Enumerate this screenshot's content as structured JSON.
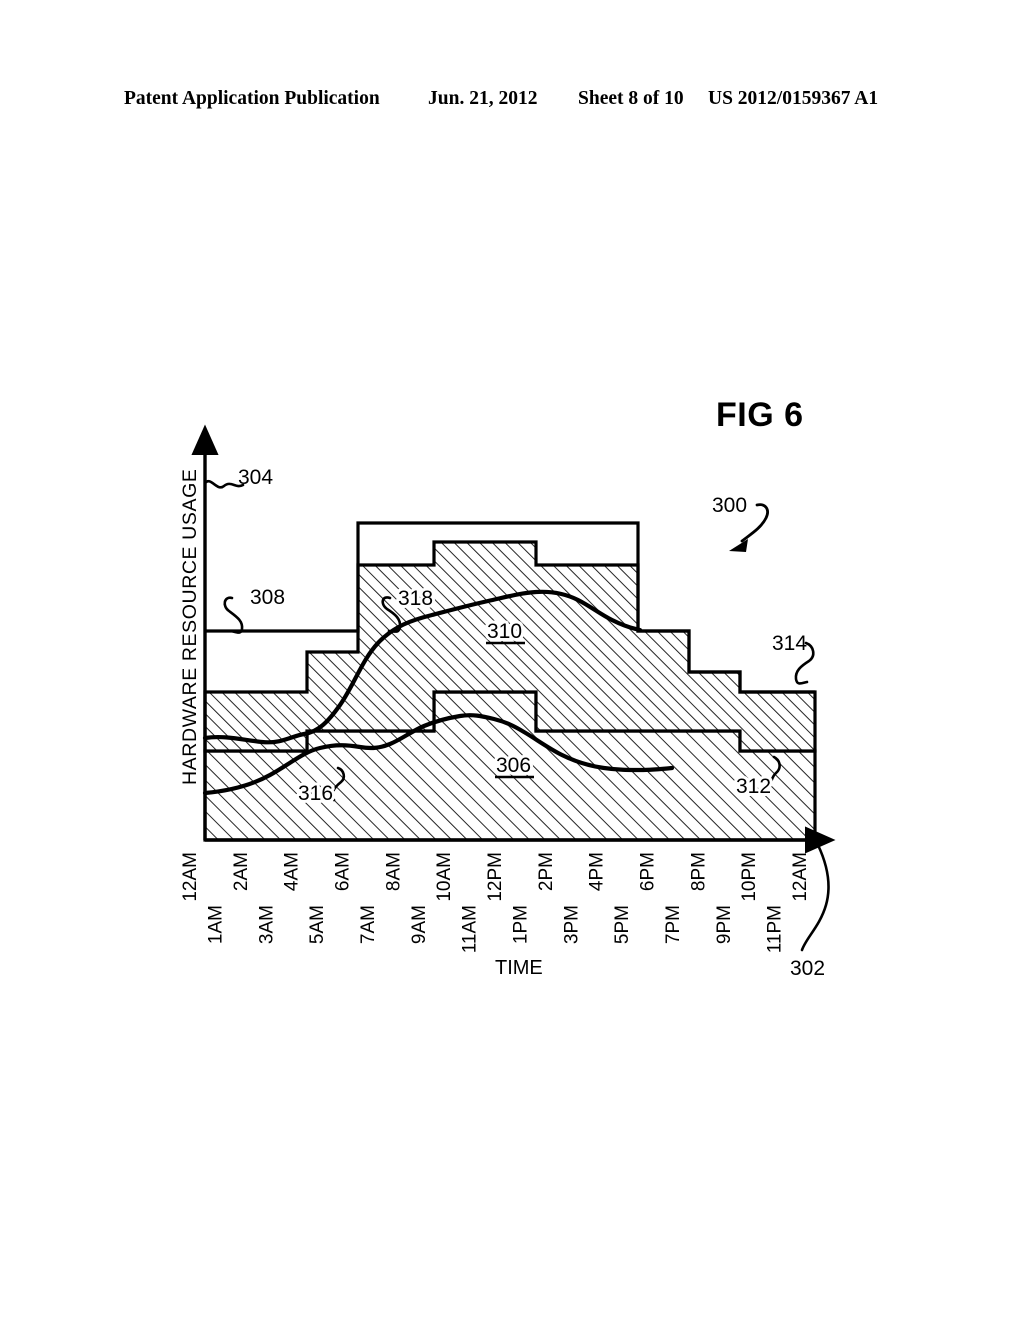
{
  "header": {
    "left": "Patent Application Publication",
    "date": "Jun. 21, 2012",
    "sheet": "Sheet 8 of 10",
    "pub_number": "US 2012/0159367 A1"
  },
  "figure": {
    "title": "FIG 6",
    "y_axis_label": "HARDWARE RESOURCE USAGE",
    "x_axis_label": "TIME",
    "reference_numerals": [
      {
        "id": "300",
        "label": "300",
        "meaning": "overall-diagram"
      },
      {
        "id": "302",
        "label": "302",
        "meaning": "time-axis"
      },
      {
        "id": "304",
        "label": "304",
        "meaning": "usage-axis"
      },
      {
        "id": "306",
        "label": "306",
        "meaning": "lower-allocation-band"
      },
      {
        "id": "308",
        "label": "308",
        "meaning": "upper-allocation-band"
      },
      {
        "id": "310",
        "label": "310",
        "meaning": "capacity-line-left"
      },
      {
        "id": "312",
        "label": "312",
        "meaning": "lower-band-right-edge"
      },
      {
        "id": "314",
        "label": "314",
        "meaning": "capacity-line-right"
      },
      {
        "id": "316",
        "label": "316",
        "meaning": "lower-usage-curve"
      },
      {
        "id": "318",
        "label": "318",
        "meaning": "upper-usage-curve"
      }
    ]
  },
  "chart_data": {
    "type": "area",
    "title": "FIG 6",
    "xlabel": "TIME",
    "ylabel": "HARDWARE RESOURCE USAGE",
    "grid": false,
    "legend": "none",
    "x_tick_labels": [
      "12AM",
      "1AM",
      "2AM",
      "3AM",
      "4AM",
      "5AM",
      "6AM",
      "7AM",
      "8AM",
      "9AM",
      "10AM",
      "11AM",
      "12PM",
      "1PM",
      "2PM",
      "3PM",
      "4PM",
      "5PM",
      "6PM",
      "7PM",
      "8PM",
      "9PM",
      "10PM",
      "11PM",
      "12AM"
    ],
    "x_tick_rows": [
      "top",
      "bottom",
      "top",
      "bottom",
      "top",
      "bottom",
      "top",
      "bottom",
      "top",
      "bottom",
      "top",
      "bottom",
      "top",
      "bottom",
      "top",
      "bottom",
      "top",
      "bottom",
      "top",
      "bottom",
      "top",
      "bottom",
      "top",
      "bottom",
      "top"
    ],
    "ylim": [
      0,
      10
    ],
    "xlim": [
      0,
      24
    ],
    "series": [
      {
        "name": "306",
        "kind": "step-area",
        "description": "Lower hardware allocation band (stacked, bottom)",
        "step_x": [
          0,
          4,
          10,
          14,
          22,
          24
        ],
        "step_y": [
          3.4,
          3.9,
          4.4,
          3.9,
          3.1,
          3.1
        ]
      },
      {
        "name": "308",
        "kind": "step-area",
        "description": "Upper hardware allocation band (stacked above 306)",
        "step_x": [
          0,
          4,
          6,
          10,
          14,
          18,
          22,
          24
        ],
        "step_y": [
          4.4,
          6.3,
          7.3,
          8.2,
          7.3,
          6.2,
          5.2,
          5.2
        ]
      },
      {
        "name": "310 / 314",
        "kind": "step-line",
        "description": "Provisioned capacity outline above usage bands",
        "step_x": [
          0,
          4,
          6,
          18,
          20,
          22,
          24
        ],
        "step_y": [
          6.3,
          6.3,
          8.2,
          8.2,
          6.3,
          5.2,
          5.2
        ]
      },
      {
        "name": "316",
        "kind": "curve",
        "description": "Actual usage curve inside lower band",
        "x": [
          0,
          1.5,
          3,
          4.2,
          5,
          6,
          7,
          8.2,
          9.4,
          11,
          12.5,
          14,
          15.5,
          16.5
        ],
        "y": [
          2.55,
          2.7,
          3.2,
          3.6,
          3.5,
          3.75,
          3.9,
          3.85,
          3.6,
          3.15,
          2.8,
          2.6,
          2.55,
          2.6
        ]
      },
      {
        "name": "318",
        "kind": "curve",
        "description": "Actual usage curve inside upper band",
        "x": [
          0,
          1.2,
          2.4,
          3.6,
          4.4,
          5.4,
          6.6,
          8,
          9.4,
          11,
          12.4,
          13.6,
          14.8,
          16
        ],
        "y": [
          4.75,
          4.8,
          4.65,
          4.7,
          5.2,
          6.0,
          6.5,
          6.75,
          7.1,
          7.3,
          7.1,
          6.7,
          6.45,
          6.4
        ]
      }
    ]
  }
}
